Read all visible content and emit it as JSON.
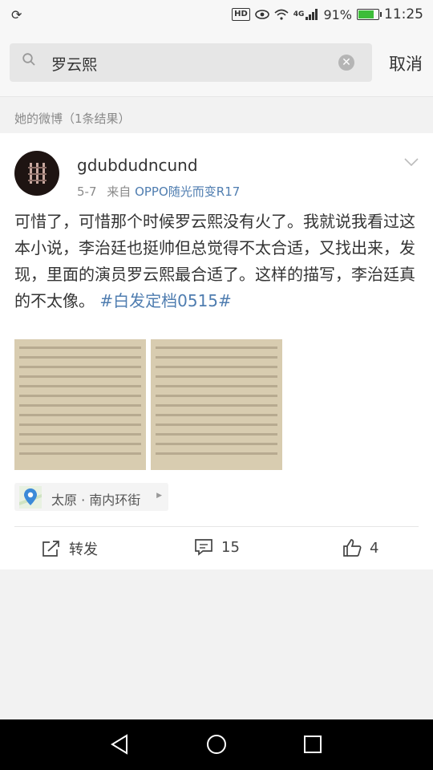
{
  "status_bar": {
    "hd": "HD",
    "network": "4G",
    "battery": "91%",
    "time": "11:25"
  },
  "search": {
    "query": "罗云熙",
    "clear_icon": "clear-icon",
    "cancel_label": "取消"
  },
  "section": {
    "title": "她的微博（1条结果）"
  },
  "post": {
    "username": "gdubdudncund",
    "date": "5-7",
    "from_label": "来自",
    "source": "OPPO随光而变R17",
    "text": "可惜了，可惜那个时候罗云熙没有火了。我就说我看过这本小说，李治廷也挺帅但总觉得不太合适，又找出来，发现，里面的演员罗云熙最合适了。这样的描写，李治廷真的不太像。",
    "hashtag": "#白发定档0515#",
    "location": "太原 · 南内环街",
    "actions": {
      "repost_label": "转发",
      "comment_count": "15",
      "like_count": "4"
    }
  },
  "colors": {
    "link_blue": "#4f7db0",
    "bg_gray": "#f2f2f2",
    "battery_green": "#3dbd39"
  }
}
